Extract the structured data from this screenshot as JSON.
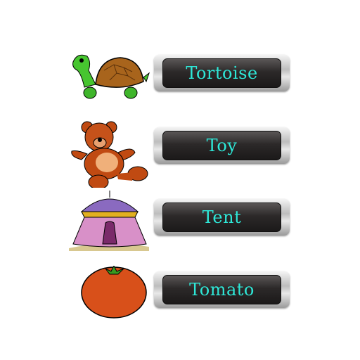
{
  "items": [
    {
      "label": "Tortoise",
      "icon": "tortoise-icon"
    },
    {
      "label": "Toy",
      "icon": "teddy-bear-icon"
    },
    {
      "label": "Tent",
      "icon": "tent-icon"
    },
    {
      "label": "Tomato",
      "icon": "tomato-icon"
    }
  ],
  "colors": {
    "label_text": "#2ee8d8",
    "button_dark": "#2c2929"
  }
}
